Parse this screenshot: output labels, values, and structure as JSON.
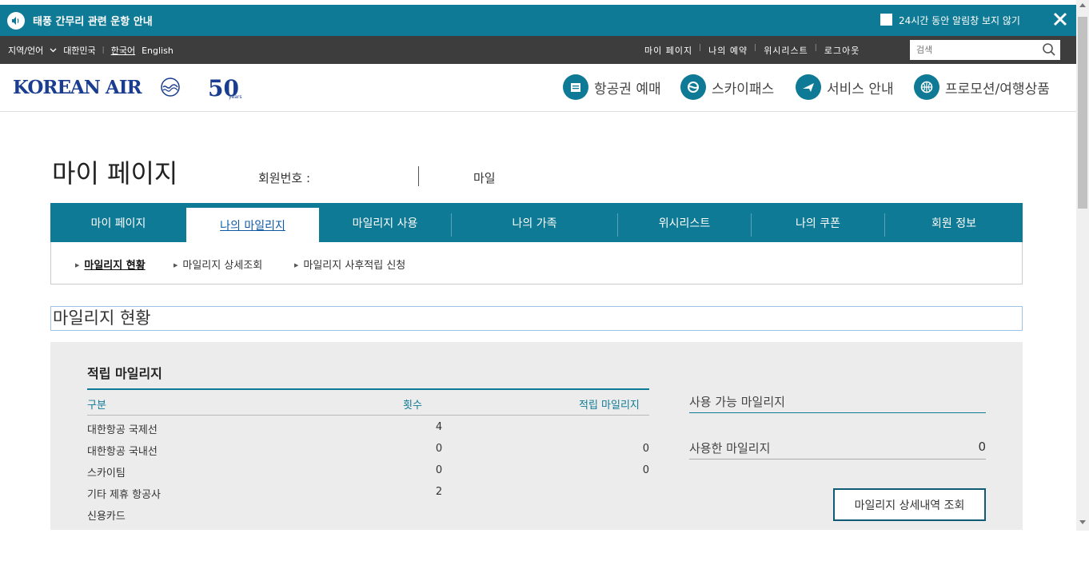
{
  "notice": {
    "message": "태풍 간무리 관련 운항 안내",
    "hide_label": "24시간 동안 알림창 보지 않기"
  },
  "util": {
    "region": "지역/언어",
    "country": "대한민국",
    "lang_ko": "한국어",
    "lang_en": "English",
    "links": [
      "마이 페이지",
      "나의 예약",
      "위시리스트",
      "로그아웃"
    ],
    "search_placeholder": "검색"
  },
  "header": {
    "logo": "KOREAN AIR",
    "fifty": "50",
    "fifty_sub": "years",
    "gnb": [
      "항공권 예매",
      "스카이패스",
      "서비스 안내",
      "프로모션/여행상품"
    ]
  },
  "page": {
    "title": "마이 페이지",
    "member_no_label": "회원번호 :",
    "mile_label": "마일"
  },
  "tabs": [
    "마이 페이지",
    "나의 마일리지",
    "마일리지 사용",
    "나의 가족",
    "위시리스트",
    "나의 쿠폰",
    "회원 정보"
  ],
  "subnav": [
    "마일리지 현황",
    "마일리지 상세조회",
    "마일리지 사후적립 신청"
  ],
  "section_title": "마일리지 현황",
  "accrual": {
    "title": "적립 마일리지",
    "headers": [
      "구분",
      "횟수",
      "적립 마일리지"
    ],
    "rows": [
      {
        "name": "대한항공 국제선",
        "count": "4",
        "miles": ""
      },
      {
        "name": "대한항공 국내선",
        "count": "0",
        "miles": "0"
      },
      {
        "name": "스카이팀",
        "count": "0",
        "miles": "0"
      },
      {
        "name": "기타 제휴 항공사",
        "count": "2",
        "miles": ""
      },
      {
        "name": "신용카드",
        "count": "",
        "miles": ""
      }
    ]
  },
  "available": {
    "title": "사용 가능 마일리지",
    "used_label": "사용한 마일리지",
    "used_value": "0",
    "detail_button": "마일리지 상세내역 조회"
  },
  "colors": {
    "accent": "#0f7a95",
    "util_bg": "#3d3d3d",
    "brand_blue": "#1a3d8f",
    "panel_bg": "#ececec"
  }
}
